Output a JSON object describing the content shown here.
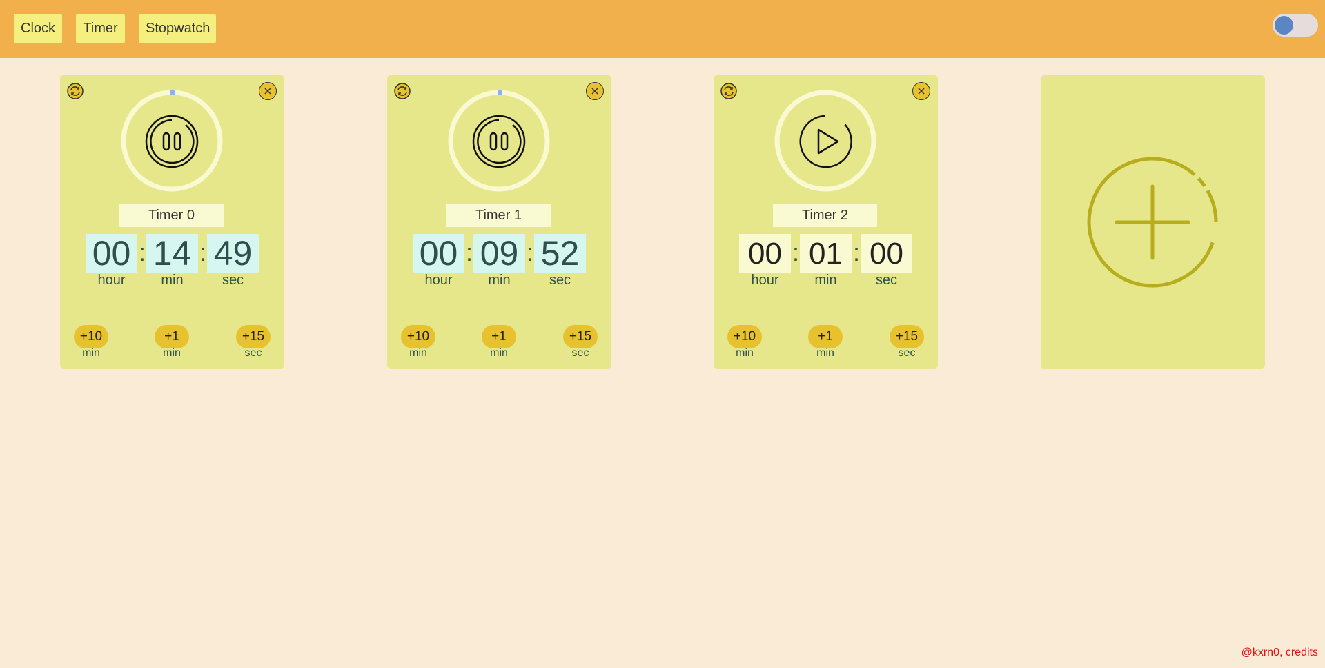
{
  "nav": {
    "clock_label": "Clock",
    "timer_label": "Timer",
    "stopwatch_label": "Stopwatch"
  },
  "timers": [
    {
      "name": "Timer 0",
      "state": "running",
      "hours": "00",
      "minutes": "14",
      "seconds": "49",
      "control_icon": "pause-icon"
    },
    {
      "name": "Timer 1",
      "state": "running",
      "hours": "00",
      "minutes": "09",
      "seconds": "52",
      "control_icon": "pause-icon"
    },
    {
      "name": "Timer 2",
      "state": "idle",
      "hours": "00",
      "minutes": "01",
      "seconds": "00",
      "control_icon": "play-icon"
    }
  ],
  "labels": {
    "hour": "hour",
    "min": "min",
    "sec": "sec",
    "colon": ":"
  },
  "increments": [
    {
      "value": "+10",
      "unit": "min"
    },
    {
      "value": "+1",
      "unit": "min"
    },
    {
      "value": "+15",
      "unit": "sec"
    }
  ],
  "colors": {
    "header": "#f2b04d",
    "card": "#e6e68b",
    "accent": "#e8c12e",
    "running_digit_bg": "#d6f7ef",
    "ring_indicator": "#8ab4e8",
    "add_icon": "#b8ad1d"
  },
  "icons": {
    "reset": "reset-icon",
    "close": "close-icon",
    "add": "add-timer-icon"
  },
  "credits": "@kxrn0, credits"
}
